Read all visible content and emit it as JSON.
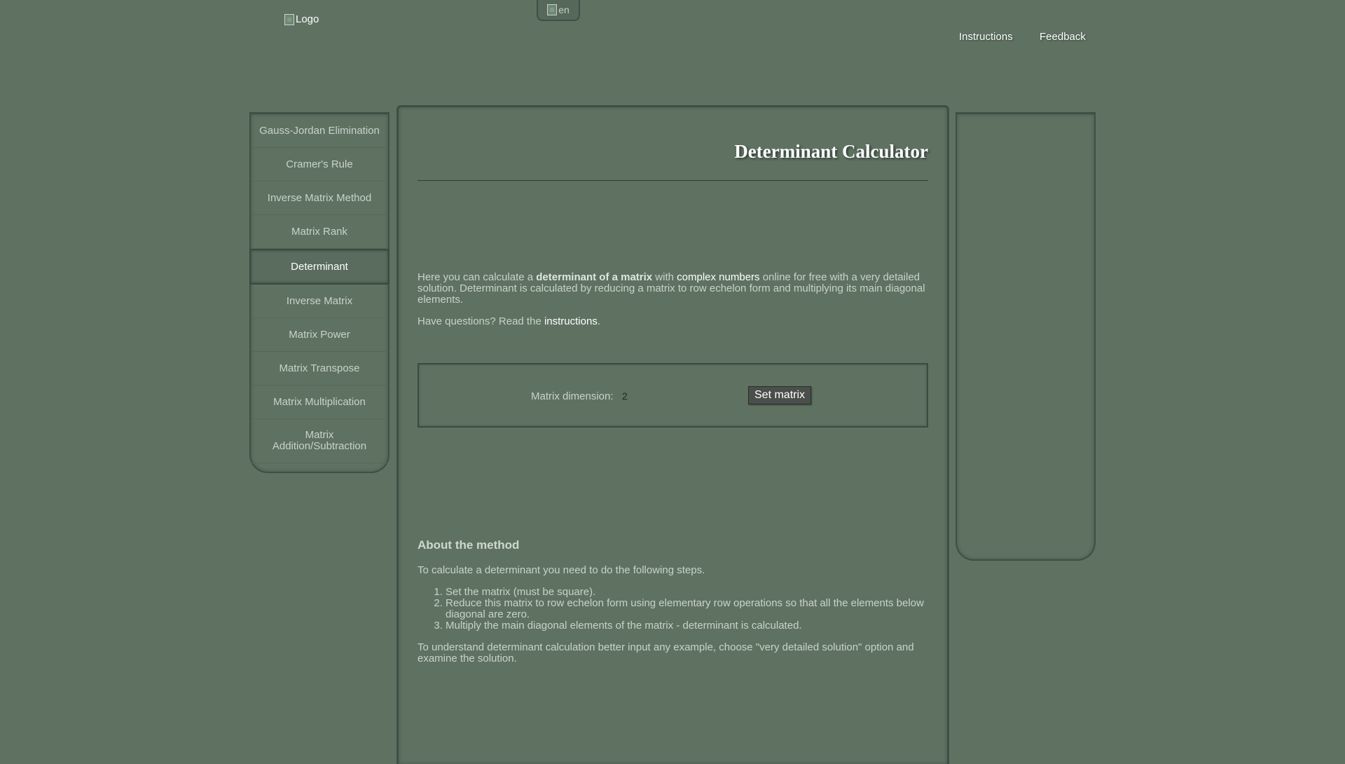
{
  "header": {
    "logo_alt": "Logo",
    "language_alt": "en",
    "nav": [
      {
        "label": "Instructions"
      },
      {
        "label": "Feedback"
      }
    ]
  },
  "sidebar": {
    "items": [
      {
        "label": "Gauss-Jordan Elimination"
      },
      {
        "label": "Cramer's Rule"
      },
      {
        "label": "Inverse Matrix Method"
      },
      {
        "label": "Matrix Rank"
      },
      {
        "label": "Determinant",
        "active": true
      },
      {
        "label": "Inverse Matrix"
      },
      {
        "label": "Matrix Power"
      },
      {
        "label": "Matrix Transpose"
      },
      {
        "label": "Matrix Multiplication"
      },
      {
        "label": "Matrix Addition/Subtraction"
      }
    ]
  },
  "main": {
    "title": "Determinant Calculator",
    "intro": {
      "p1_a": "Here you can calculate a ",
      "p1_bold": "determinant of a matrix",
      "p1_b": " with ",
      "p1_link": "complex numbers",
      "p1_c": " online for free with a very detailed solution. Determinant is calculated by reducing a matrix to row echelon form and multiplying its main diagonal elements.",
      "p2_a": "Have questions? Read the ",
      "p2_link": "instructions",
      "p2_b": "."
    },
    "form": {
      "dimension_label": "Matrix dimension:",
      "dimension_value": "2",
      "set_button": "Set matrix"
    },
    "about": {
      "heading": "About the method",
      "lead": "To calculate a determinant you need to do the following steps.",
      "steps": [
        "Set the matrix (must be square).",
        "Reduce this matrix to row echelon form using elementary row operations so that all the elements below diagonal are zero.",
        "Multiply the main diagonal elements of the matrix - determinant is calculated."
      ],
      "closing": "To understand determinant calculation better input any example, choose \"very detailed solution\" option and examine the solution."
    }
  },
  "colors": {
    "background": "#5f7262",
    "panel_border": "#3f4f44",
    "link": "#ffffff",
    "button": "#4a4f4b"
  }
}
